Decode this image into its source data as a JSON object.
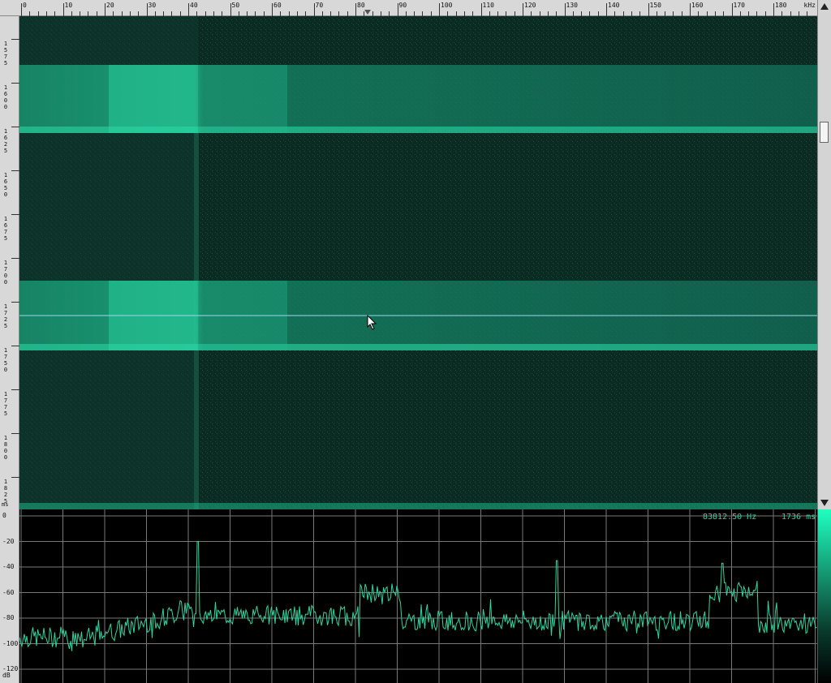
{
  "freq_axis": {
    "ticks": [
      "0",
      "10",
      "20",
      "30",
      "40",
      "50",
      "60",
      "70",
      "80",
      "90",
      "100",
      "110",
      "120",
      "130",
      "140",
      "150",
      "160",
      "170",
      "180"
    ],
    "unit": "kHz"
  },
  "time_axis": {
    "ticks": [
      "1575",
      "1600",
      "1625",
      "1650",
      "1675",
      "1700",
      "1725",
      "1750",
      "1775",
      "1800",
      "1825"
    ],
    "unit": "ms"
  },
  "db_axis": {
    "ticks": [
      "0",
      "-20",
      "-40",
      "-60",
      "-80",
      "-100",
      "-120"
    ],
    "unit": "dB"
  },
  "readout": {
    "frequency": "83812.50 Hz",
    "time": "1736 ms"
  },
  "colors": {
    "spectrum_line": "#2bd6a0",
    "waterfall_bg": "#0b2a22",
    "band": "#1fbf8f"
  },
  "icons": {
    "cursor": "mouse-pointer-icon",
    "scroll_up": "arrow-up-icon",
    "scroll_down": "arrow-down-icon",
    "marker": "frequency-marker-icon"
  }
}
